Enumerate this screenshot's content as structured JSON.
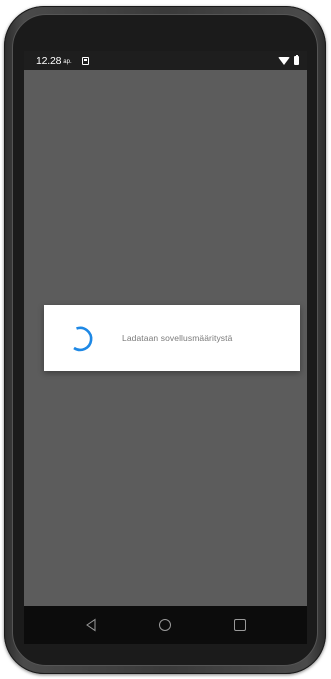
{
  "status_bar": {
    "time": "12.28",
    "ampm": "ap.",
    "icons": [
      "notification-icon",
      "wifi-icon",
      "battery-icon"
    ]
  },
  "dialog": {
    "message": "Ladataan sovellusmääritystä",
    "spinner_color": "#1e88e5"
  },
  "nav_bar": {
    "buttons": [
      "back",
      "home",
      "recents"
    ]
  },
  "colors": {
    "screen_bg": "#5c5c5c",
    "status_bar_bg": "#1e1e1e",
    "nav_bar_bg": "#0c0c0c",
    "dialog_bg": "#ffffff",
    "text_muted": "#7a7a7a"
  }
}
